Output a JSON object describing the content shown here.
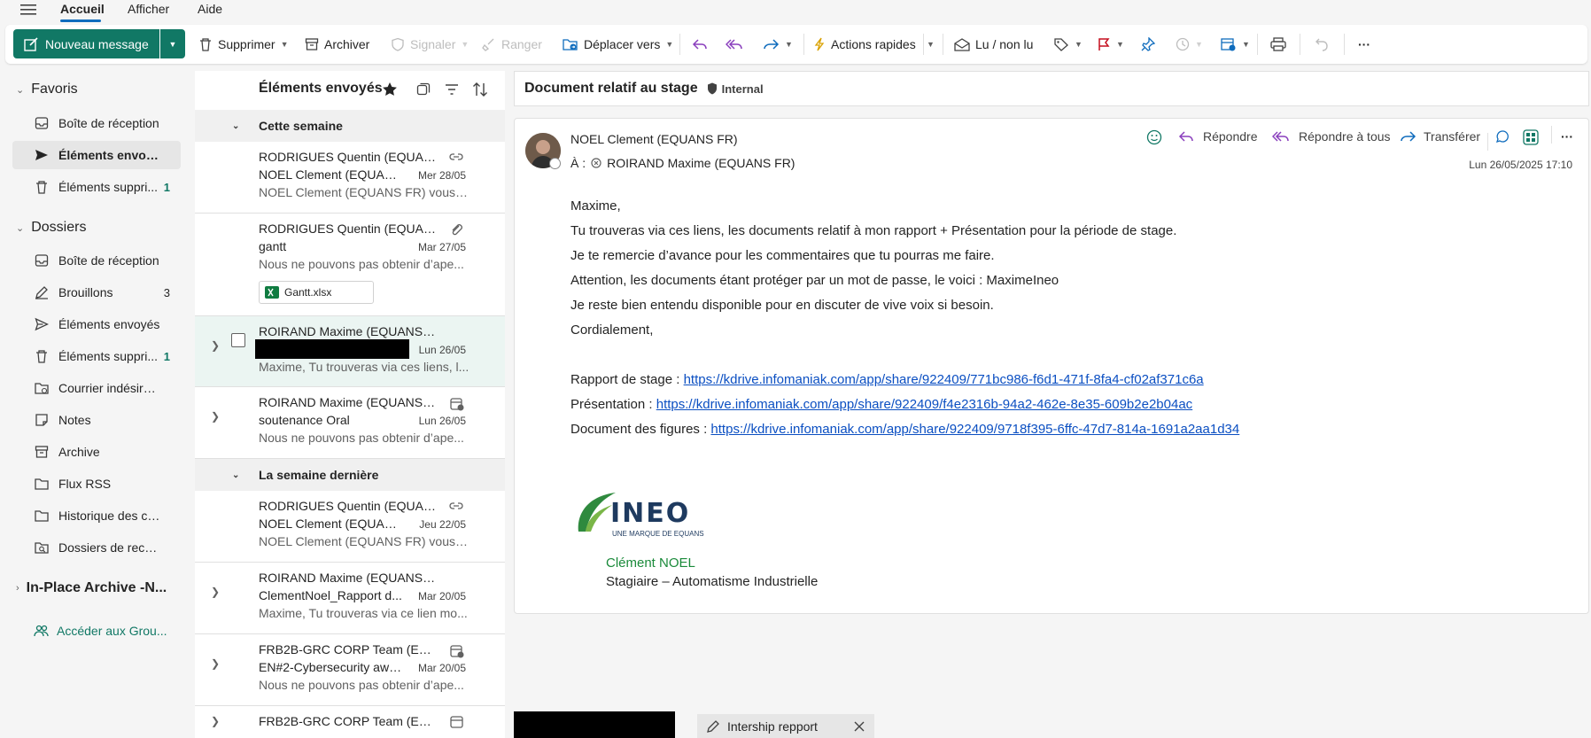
{
  "menu": {
    "tabs": [
      "Accueil",
      "Afficher",
      "Aide"
    ]
  },
  "toolbar": {
    "new_message": "Nouveau message",
    "delete": "Supprimer",
    "archive": "Archiver",
    "report": "Signaler",
    "sweep": "Ranger",
    "move_to": "Déplacer vers",
    "quick_actions": "Actions rapides",
    "read_unread": "Lu / non lu",
    "more": "···"
  },
  "nav": {
    "favorites_title": "Favoris",
    "favorites": [
      {
        "label": "Boîte de réception",
        "count": ""
      },
      {
        "label": "Éléments envoyés",
        "count": ""
      },
      {
        "label": "Éléments suppri...",
        "count": "1"
      }
    ],
    "folders_title": "Dossiers",
    "folders": [
      {
        "label": "Boîte de réception",
        "count": ""
      },
      {
        "label": "Brouillons",
        "count": "3"
      },
      {
        "label": "Éléments envoyés",
        "count": ""
      },
      {
        "label": "Éléments suppri...",
        "count": "1"
      },
      {
        "label": "Courrier indésirable",
        "count": ""
      },
      {
        "label": "Notes",
        "count": ""
      },
      {
        "label": "Archive",
        "count": ""
      },
      {
        "label": "Flux RSS",
        "count": ""
      },
      {
        "label": "Historique des con...",
        "count": ""
      },
      {
        "label": "Dossiers de recher...",
        "count": ""
      }
    ],
    "archive_title": "In-Place Archive -N...",
    "groups_link": "Accéder aux Grou..."
  },
  "list": {
    "title": "Éléments envoyés",
    "group_this_week": "Cette semaine",
    "group_last_week": "La semaine dernière",
    "messages": [
      {
        "from": "RODRIGUES Quentin (EQUAN...",
        "subject": "NOEL Clement (EQUANS...",
        "date": "Mer 28/05",
        "preview": "NOEL Clement (EQUANS FR) vous a ..."
      },
      {
        "from": "RODRIGUES Quentin (EQUAN...",
        "subject": "gantt",
        "date": "Mar 27/05",
        "preview": "Nous ne pouvons pas obtenir d’ape...",
        "attachment": "Gantt.xlsx"
      },
      {
        "from": "ROIRAND Maxime (EQUANS FR)",
        "subject": "",
        "date": "Lun 26/05",
        "preview": "Maxime, Tu trouveras via ces liens, l..."
      },
      {
        "from": "ROIRAND Maxime (EQUANS FR)",
        "subject": "soutenance Oral",
        "date": "Lun 26/05",
        "preview": "Nous ne pouvons pas obtenir d’ape..."
      },
      {
        "from": "RODRIGUES Quentin (EQUAN...",
        "subject": "NOEL Clement (EQUANS ...",
        "date": "Jeu 22/05",
        "preview": "NOEL Clement (EQUANS FR) vous a ..."
      },
      {
        "from": "ROIRAND Maxime (EQUANS FR)",
        "subject": "ClementNoel_Rapport d...",
        "date": "Mar 20/05",
        "preview": "Maxime, Tu trouveras via ce lien mo..."
      },
      {
        "from": "FRB2B-GRC CORP Team (EQU...",
        "subject": "EN#2-Cybersecurity awa...",
        "date": "Mar 20/05",
        "preview": "Nous ne pouvons pas obtenir d’ape..."
      },
      {
        "from": "FRB2B-GRC CORP Team (EQU...",
        "subject": "",
        "date": "",
        "preview": ""
      }
    ]
  },
  "reading": {
    "subject": "Document relatif au stage",
    "label": "Internal",
    "sender": "NOEL Clement (EQUANS FR)",
    "to_prefix": "À :",
    "recipient": "ROIRAND Maxime (EQUANS FR)",
    "reply": "Répondre",
    "reply_all": "Répondre à tous",
    "forward": "Transférer",
    "datetime": "Lun 26/05/2025 17:10",
    "body": [
      "Maxime,",
      "Tu trouveras via ces liens, les documents relatif à mon rapport + Présentation pour la période de stage.",
      "Je te remercie d’avance pour les commentaires que tu pourras me faire.",
      "Attention, les documents étant protéger par un mot de passe, le voici : MaximeIneo",
      "Je reste bien entendu disponible pour en discuter de vive voix si besoin.",
      "Cordialement,"
    ],
    "links": [
      {
        "label": "Rapport de stage : ",
        "url": "https://kdrive.infomaniak.com/app/share/922409/771bc986-f6d1-471f-8fa4-cf02af371c6a"
      },
      {
        "label": "Présentation : ",
        "url": "https://kdrive.infomaniak.com/app/share/922409/f4e2316b-94a2-462e-8e35-609b2e2b04ac"
      },
      {
        "label": "Document des figures : ",
        "url": "https://kdrive.infomaniak.com/app/share/922409/9718f395-6ffc-47d7-814a-1691a2aa1d34"
      }
    ],
    "logo_text": "INEO",
    "logo_tagline": "UNE MARQUE DE EQUANS",
    "signature_name": "Clément NOEL",
    "signature_title": "Stagiaire – Automatisme Industrielle"
  },
  "bottom": {
    "draft_tab": "Intership repport"
  },
  "colors": {
    "accent": "#117865",
    "link": "#0b4fc2",
    "brand_green": "#1a8a3a",
    "flag": "#c50f1f",
    "reply": "#8a3fbd"
  }
}
